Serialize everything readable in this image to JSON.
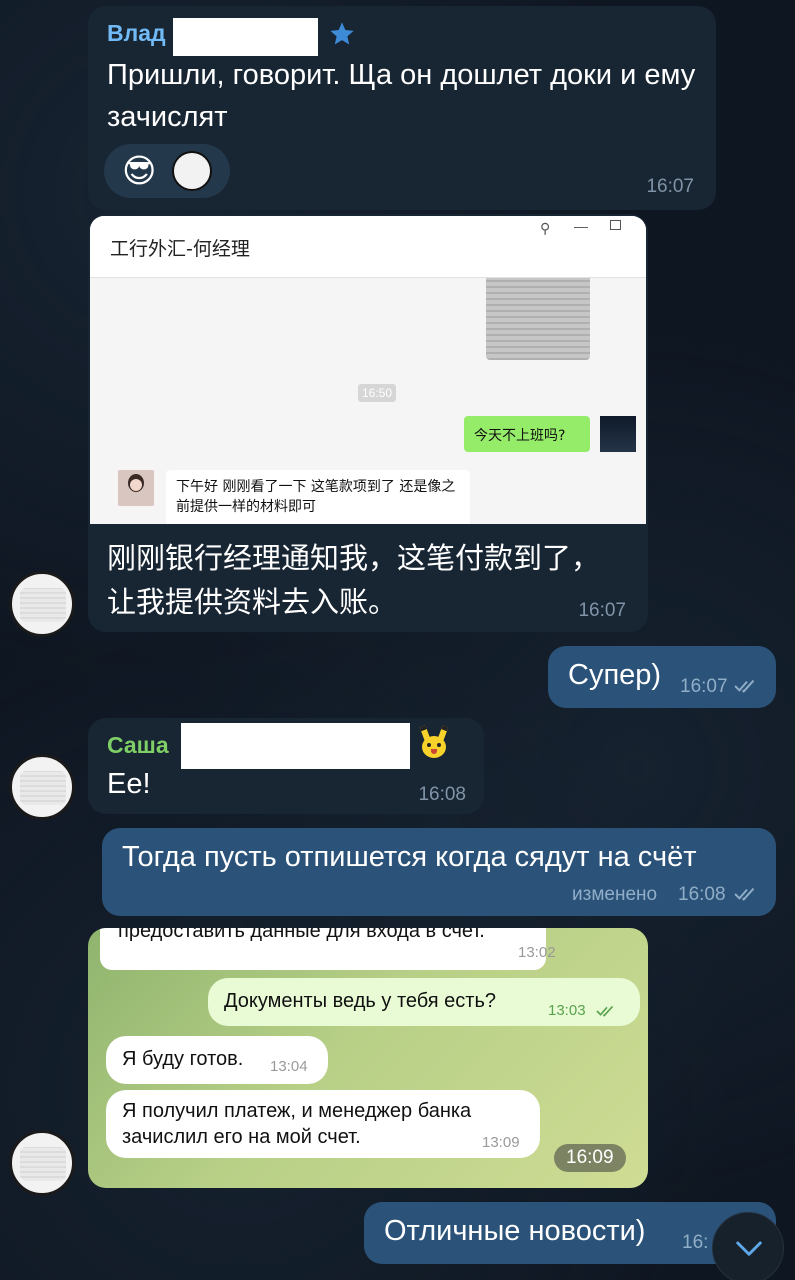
{
  "messages": {
    "m1": {
      "sender": "Влад",
      "text": "Пришли, говорит. Ща он дошлет доки и ему зачислят",
      "time": "16:07",
      "reactions": [
        "😎"
      ]
    },
    "m2": {
      "screenshot": {
        "title": "工行外汇-何经理",
        "time": "16:50",
        "sent_text": "今天不上班吗?",
        "recv_text": "下午好 刚刚看了一下 这笔款项到了 还是像之前提供一样的材料即可"
      },
      "text": "刚刚银行经理通知我，这笔付款到了，让我提供资料去入账。",
      "time": "16:07"
    },
    "m3": {
      "text": "Супер)",
      "time": "16:07"
    },
    "m4": {
      "sender": "Саша",
      "sender_emoji": "🐭",
      "text": "Ee!",
      "time": "16:08"
    },
    "m5": {
      "text": "Тогда пусть отпишется когда сядут на счёт",
      "edited": "изменено",
      "time": "16:08"
    },
    "m6": {
      "screenshot": {
        "cut_text": "предоставить данные для входа в счет.",
        "cut_time": "13:02",
        "out_text": "Документы ведь у тебя есть?",
        "out_time": "13:03",
        "in1_text": "Я буду готов.",
        "in1_time": "13:04",
        "in2_text": "Я получил платеж, и менеджер банка зачислил его на мой счет.",
        "in2_time": "13:09"
      },
      "time": "16:09"
    },
    "m7": {
      "text": "Отличные новости)",
      "time": "16:"
    }
  },
  "colors": {
    "background": "#0e1621",
    "incoming": "#182533",
    "outgoing": "#2b5278",
    "sender_vlad": "#71baf5",
    "sender_sasha": "#7fcf66"
  },
  "icons": {
    "star": "star-icon",
    "read": "double-check-icon",
    "scroll_down": "chevron-down-icon"
  }
}
